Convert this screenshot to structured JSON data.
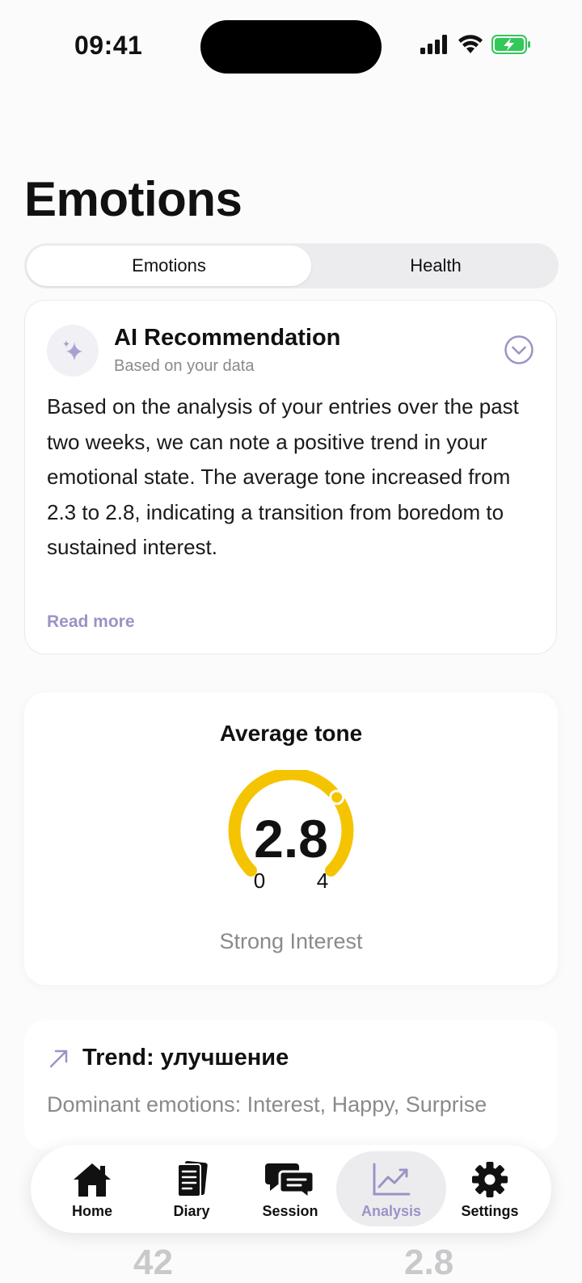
{
  "status_bar": {
    "time": "09:41"
  },
  "page": {
    "title": "Emotions"
  },
  "segments": [
    "Emotions",
    "Health"
  ],
  "ai_card": {
    "title": "AI Recommendation",
    "subtitle": "Based on your data",
    "body": "Based on the analysis of your entries over the past two weeks, we can note a positive trend in your emotional state. The average tone increased from 2.3 to 2.8, indicating a transition from boredom to sustained interest.",
    "read_more": "Read more",
    "icon": "sparkle-icon"
  },
  "tone_card": {
    "title": "Average tone",
    "value": "2.8",
    "level": 0.7,
    "min": "0",
    "max": "4",
    "label": "Strong Interest",
    "gauge_color": "#f5c400"
  },
  "trend_card": {
    "title": "Trend: улучшение",
    "subtitle": "Dominant emotions: Interest, Happy, Surprise",
    "icon": "arrow-up-right-icon"
  },
  "behind_tabbar": [
    "42",
    "2.8"
  ],
  "tab_bar": {
    "tabs": [
      {
        "label": "Home",
        "icon": "home-icon"
      },
      {
        "label": "Diary",
        "icon": "diary-icon"
      },
      {
        "label": "Session",
        "icon": "chat-icon"
      },
      {
        "label": "Analysis",
        "icon": "chart-icon",
        "active": true
      },
      {
        "label": "Settings",
        "icon": "gear-icon"
      }
    ]
  },
  "colors": {
    "accent": "#9b93c6",
    "gauge": "#f5c400",
    "battery": "#34c759"
  }
}
